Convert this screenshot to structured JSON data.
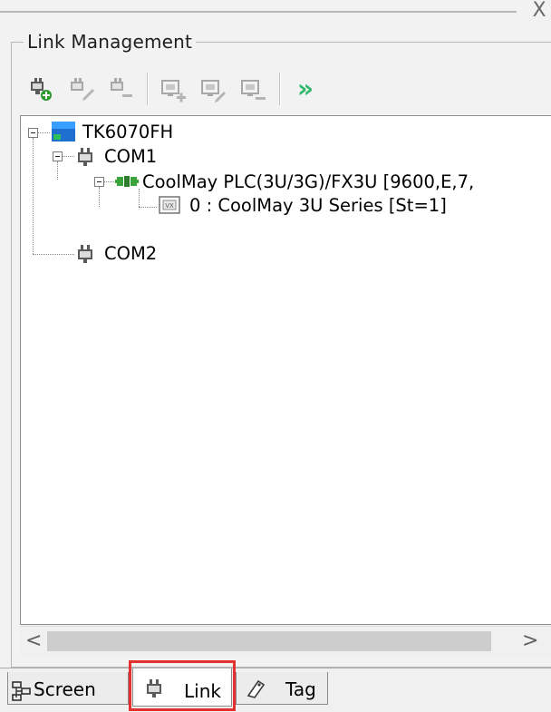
{
  "panel": {
    "close_label": "X",
    "title": "Link Management"
  },
  "toolbar": {
    "buttons": [
      {
        "icon": "add-link-icon"
      },
      {
        "icon": "edit-link-icon"
      },
      {
        "icon": "delete-link-icon"
      },
      {
        "icon": "add-device-icon"
      },
      {
        "icon": "edit-device-icon"
      },
      {
        "icon": "delete-device-icon"
      },
      {
        "icon": "forward-chevron-icon",
        "label": "»"
      }
    ]
  },
  "tree": {
    "root": "TK6070FH",
    "com1": "COM1",
    "plc": "CoolMay PLC(3U/3G)/FX3U [9600,E,7,",
    "device": "0 : CoolMay 3U Series [St=1]",
    "com2": "COM2"
  },
  "scroll": {
    "left": "<",
    "right": ">"
  },
  "tabs": [
    {
      "label": "Screen"
    },
    {
      "label": "Link",
      "active": true
    },
    {
      "label": "Tag"
    }
  ],
  "colors": {
    "accent_highlight": "#e53030",
    "forward_chevron": "#2fb86a",
    "plc_green": "#3aa43a"
  }
}
